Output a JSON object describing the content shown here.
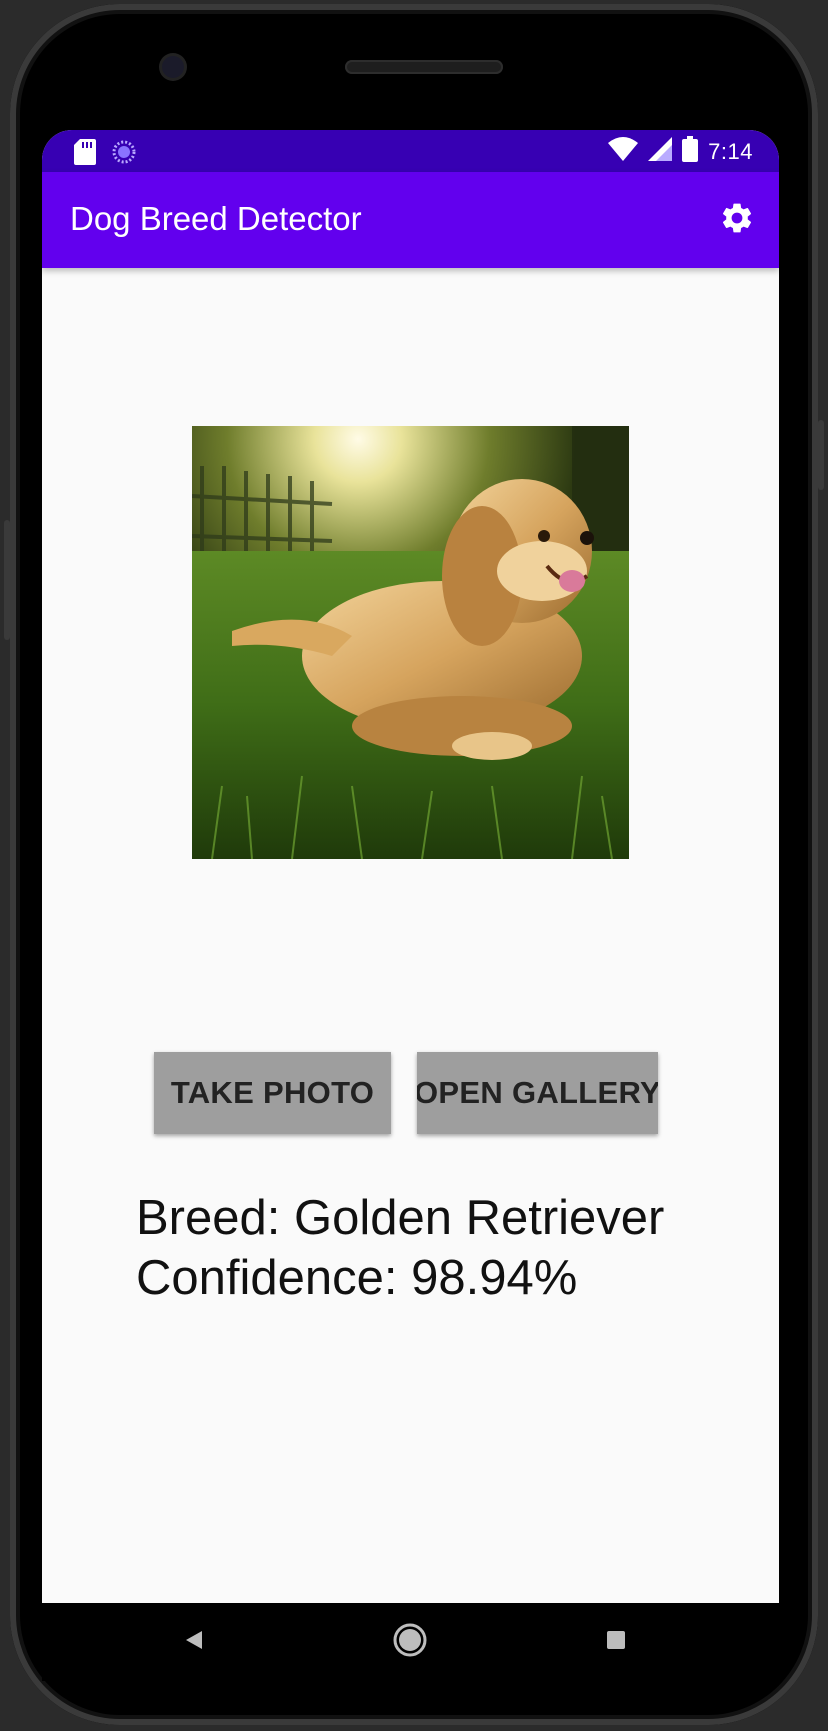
{
  "status_bar": {
    "time": "7:14",
    "icons": [
      "sd-card-icon",
      "loading-icon",
      "wifi-icon",
      "signal-icon",
      "battery-icon"
    ]
  },
  "app_bar": {
    "title": "Dog Breed Detector",
    "action_icon": "settings-gear-icon"
  },
  "main": {
    "image_subject": "golden retriever lying in grass",
    "buttons": {
      "take_photo": "TAKE PHOTO",
      "open_gallery": "OPEN GALLERY"
    },
    "result": {
      "breed": "Breed: Golden Retriever",
      "confidence": "Confidence: 98.94%"
    }
  },
  "nav_bar": {
    "items": [
      "back-icon",
      "home-icon",
      "recents-icon"
    ]
  },
  "colors": {
    "status_bar": "#3700b3",
    "app_bar": "#6200ee",
    "button": "#9e9e9e",
    "background": "#fafafa"
  }
}
